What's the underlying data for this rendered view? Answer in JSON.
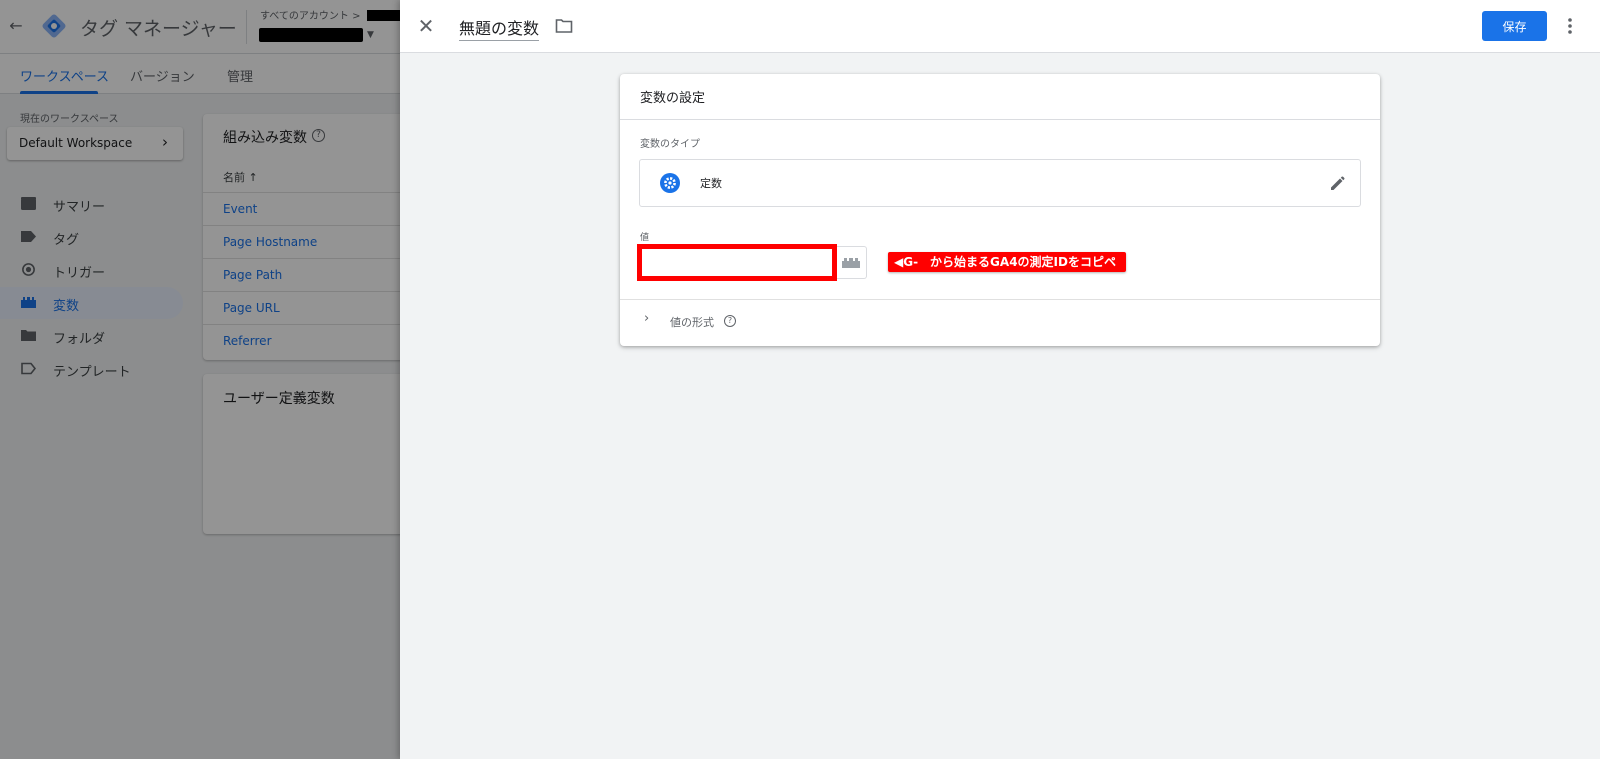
{
  "app": {
    "back_icon": "back-arrow-icon",
    "logo_icon": "gtm-diamond-logo",
    "title": "タグ マネージャー",
    "account_label": "すべてのアカウント >"
  },
  "workspace_tabs": [
    {
      "label": "ワークスペース",
      "active": true
    },
    {
      "label": "バージョン",
      "active": false
    },
    {
      "label": "管理",
      "active": false
    }
  ],
  "workspace": {
    "current_label": "現在のワークスペース",
    "name": "Default Workspace"
  },
  "sidebar": {
    "items": [
      {
        "label": "サマリー",
        "icon": "summary-icon",
        "active": false
      },
      {
        "label": "タグ",
        "icon": "tag-icon",
        "active": false
      },
      {
        "label": "トリガー",
        "icon": "trigger-icon",
        "active": false
      },
      {
        "label": "変数",
        "icon": "variables-icon",
        "active": true
      },
      {
        "label": "フォルダ",
        "icon": "folder-icon",
        "active": false
      },
      {
        "label": "テンプレート",
        "icon": "template-icon",
        "active": false
      }
    ]
  },
  "builtin_variables": {
    "title": "組み込み変数",
    "column_header": "名前 ↑",
    "rows": [
      "Event",
      "Page Hostname",
      "Page Path",
      "Page URL",
      "Referrer"
    ]
  },
  "user_defined": {
    "title": "ユーザー定義変数"
  },
  "editor": {
    "variable_name": "無題の変数",
    "save_label": "保存",
    "config_title": "変数の設定",
    "type_label": "変数のタイプ",
    "type_name": "定数",
    "value_label": "値",
    "value": "",
    "annotation": "◀G-　から始まるGA4の測定IDをコピペ",
    "format_label": "値の形式",
    "accent_color": "#1a73e8",
    "highlight_color": "#ff0000"
  }
}
